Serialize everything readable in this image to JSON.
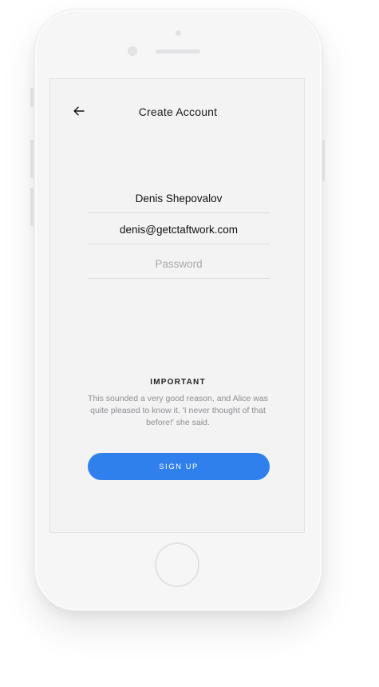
{
  "header": {
    "title": "Create Account",
    "back_icon": "arrow-left-icon"
  },
  "form": {
    "name_value": "Denis Shepovalov",
    "email_value": "denis@getctaftwork.com",
    "password_value": "",
    "password_placeholder": "Password"
  },
  "notice": {
    "title": "IMPORTANT",
    "text": "This sounded a very good reason, and Alice was quite pleased to know it. 'I never thought of that before!' she said."
  },
  "actions": {
    "signup_label": "SIGN UP"
  },
  "colors": {
    "accent": "#2f80ed",
    "screen_background": "#f3f3f4",
    "phone_body": "#f6f6f7"
  }
}
